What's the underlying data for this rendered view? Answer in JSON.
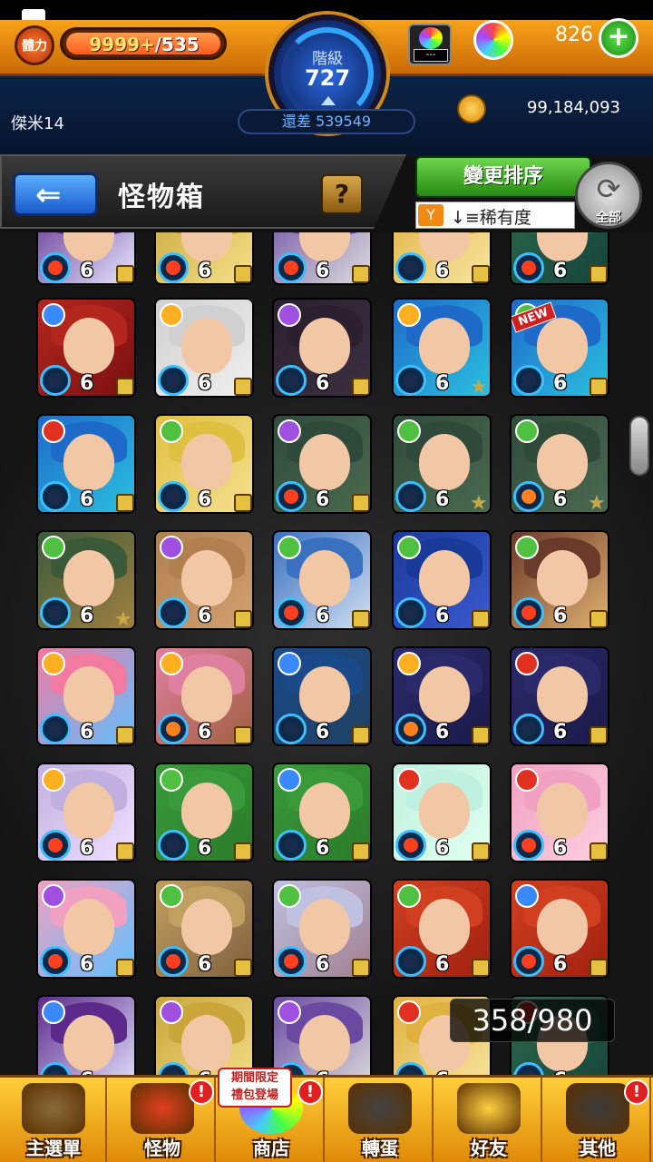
{
  "header": {
    "stamina_label": "體力",
    "stamina_value": "9999+",
    "stamina_max": "/535",
    "rank_label": "階級",
    "rank_value": "727",
    "box_value": "---",
    "orb_count": "826",
    "player_name": "傑米14",
    "exp_remaining": "還差 539549",
    "coins": "99,184,093"
  },
  "title": {
    "text": "怪物箱",
    "help": "?"
  },
  "sort": {
    "button_label": "變更排序",
    "current": "稀有度",
    "refresh_label": "全部"
  },
  "box_count": "358/980",
  "monsters": {
    "level": "6",
    "new_tag": "NEW"
  },
  "nav": [
    {
      "label": "主選單",
      "icon": "gate-icon"
    },
    {
      "label": "怪物",
      "icon": "monster-icon"
    },
    {
      "label": "商店",
      "icon": "orb-icon"
    },
    {
      "label": "轉蛋",
      "icon": "gacha-icon"
    },
    {
      "label": "好友",
      "icon": "friends-icon"
    },
    {
      "label": "其他",
      "icon": "other-icon"
    }
  ],
  "promo_text": "期間限定\n禮包登場",
  "colors": {
    "accent_orange": "#f8a21a",
    "header_blue": "#0b2c5c",
    "sort_green": "#258a10",
    "back_blue": "#1a5acc"
  }
}
